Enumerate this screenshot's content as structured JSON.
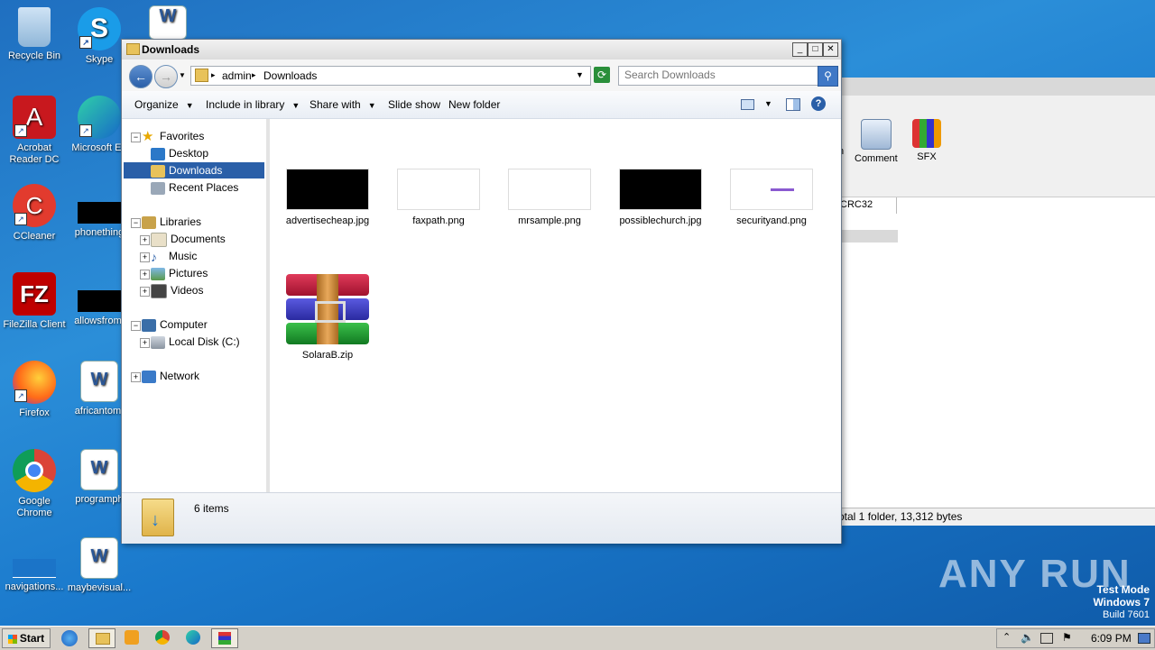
{
  "desktop": {
    "icons": [
      {
        "label": "Recycle Bin",
        "icon": "recycle-bin-icon"
      },
      {
        "label": "Skype",
        "icon": "skype-icon"
      },
      {
        "label": "Acrobat Reader DC",
        "icon": "acrobat-icon"
      },
      {
        "label": "Microsoft Ed",
        "icon": "edge-icon"
      },
      {
        "label": "CCleaner",
        "icon": "ccleaner-icon"
      },
      {
        "label": "phonething",
        "icon": "black-file-icon"
      },
      {
        "label": "FileZilla Client",
        "icon": "filezilla-icon"
      },
      {
        "label": "allowsfrom.",
        "icon": "black-file-icon"
      },
      {
        "label": "Firefox",
        "icon": "firefox-icon"
      },
      {
        "label": "africantom.",
        "icon": "word-icon"
      },
      {
        "label": "Google Chrome",
        "icon": "chrome-icon"
      },
      {
        "label": "programph",
        "icon": "word-icon"
      },
      {
        "label": "navigations...",
        "icon": "blank-file-icon"
      },
      {
        "label": "maybevisual...",
        "icon": "word-icon"
      }
    ]
  },
  "winrar_bg": {
    "tools": [
      {
        "label": "n"
      },
      {
        "label": "Comment"
      },
      {
        "label": "SFX"
      }
    ],
    "column": "CRC32",
    "status": "otal 1 folder, 13,312 bytes"
  },
  "explorer": {
    "title": "Downloads",
    "breadcrumb": [
      "admin",
      "Downloads"
    ],
    "search_placeholder": "Search Downloads",
    "commands": [
      "Organize",
      "Include in library",
      "Share with",
      "Slide show",
      "New folder"
    ],
    "nav": {
      "favorites": "Favorites",
      "desktop": "Desktop",
      "downloads": "Downloads",
      "recent": "Recent Places",
      "libraries": "Libraries",
      "documents": "Documents",
      "music": "Music",
      "pictures": "Pictures",
      "videos": "Videos",
      "computer": "Computer",
      "localdisk": "Local Disk (C:)",
      "network": "Network"
    },
    "files": [
      {
        "name": "advertisecheap.jpg"
      },
      {
        "name": "faxpath.png"
      },
      {
        "name": "mrsample.png"
      },
      {
        "name": "possiblechurch.jpg"
      },
      {
        "name": "securityand.png"
      },
      {
        "name": "SolaraB.zip"
      }
    ],
    "status_count": "6 items"
  },
  "watermark": {
    "brand": "ANY RUN",
    "mode": "Test Mode",
    "os": "Windows 7",
    "build": "Build 7601"
  },
  "taskbar": {
    "start": "Start",
    "clock": "6:09 PM"
  },
  "colors": {
    "selection": "#2a5fa8",
    "desktop": "#1f7dd0"
  }
}
